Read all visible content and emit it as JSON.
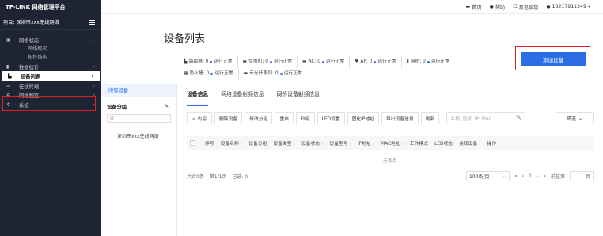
{
  "app": {
    "logo": "TP-LINK 网络管理平台",
    "project": "项目: 深圳市xxx无线网络"
  },
  "topbar": {
    "home": "首页",
    "help": "帮助",
    "feedback": "意见反馈",
    "user": "18217911249"
  },
  "sidebar": {
    "items": [
      {
        "label": "网络状态",
        "icon": "screen-icon"
      },
      {
        "label": "网络概况",
        "sub": true
      },
      {
        "label": "拓扑结构",
        "sub": true
      },
      {
        "label": "数据统计",
        "icon": "bar-chart-icon"
      },
      {
        "label": "设备列表",
        "icon": "device-list-icon",
        "active": true
      },
      {
        "label": "在线终端",
        "icon": "terminal-icon"
      },
      {
        "label": "网络配置",
        "icon": "gear-icon"
      },
      {
        "label": "系统",
        "icon": "gear-icon"
      }
    ]
  },
  "page": {
    "title": "设备列表",
    "add_button": "添加设备"
  },
  "stats": {
    "row1": [
      {
        "text": "路由器: 0",
        "status": "运行正常"
      },
      {
        "text": "交换机: 0",
        "status": "运行正常"
      },
      {
        "text": "AC: 0",
        "status": "运行正常"
      },
      {
        "text": "AP: 0",
        "status": "运行正常"
      },
      {
        "text": "网桥: 0",
        "status": "运行正常"
      }
    ],
    "row2": [
      {
        "text": "防火墙: 0",
        "status": "运行正常"
      },
      {
        "text": "云光纤系列: 0",
        "status": "运行正常"
      }
    ]
  },
  "left_panel": {
    "all_devices": "所有设备",
    "group_title": "设备分组",
    "search_placeholder": "Q",
    "project_name": "深圳市xxx无线网络"
  },
  "tabs": [
    "设备信息",
    "网络设备射频信息",
    "网桥设备射频信息"
  ],
  "toolbar": {
    "grid_label": "≡ 内容",
    "buttons": [
      "删除设备",
      "修改分组",
      "重启",
      "升级",
      "LED设置",
      "固化IP地址",
      "导出设备信息",
      "刷新"
    ],
    "search_placeholder": "名称, 型号, IP, MAC",
    "filter_label": "筛选"
  },
  "table": {
    "columns": [
      "序号",
      "设备名称",
      "设备分组",
      "设备类型",
      "设备状态",
      "设备型号",
      "IP地址",
      "MAC地址",
      "工作模式",
      "LED状态",
      "关联设备",
      "操作"
    ],
    "empty_text": "无条目"
  },
  "pager": {
    "total": "共计0条",
    "page_info": "第1/1页",
    "selected": "已选: 0",
    "page_size": "100条/页",
    "current_page": "1",
    "goto_label": "前往第",
    "page_suffix": "页"
  },
  "colors": {
    "accent": "#2b6de5",
    "sidebar_bg": "#1e2433",
    "highlight": "#e02020"
  }
}
